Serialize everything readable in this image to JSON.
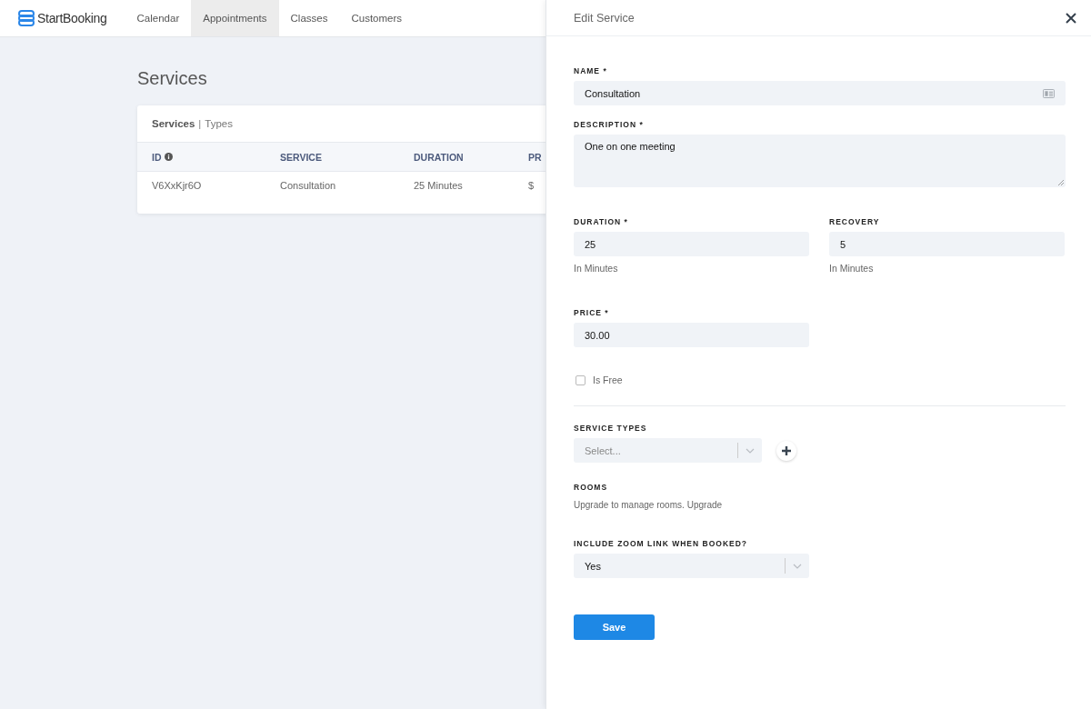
{
  "nav": {
    "brand": "StartBooking",
    "tabs": [
      {
        "label": "Calendar",
        "selected": false
      },
      {
        "label": "Appointments",
        "selected": true
      },
      {
        "label": "Classes",
        "selected": false
      },
      {
        "label": "Customers",
        "selected": false
      }
    ]
  },
  "page": {
    "title": "Services",
    "card": {
      "tabs": [
        {
          "label": "Services",
          "selected": true
        },
        {
          "label": "Types",
          "selected": false
        }
      ],
      "separator": "|",
      "columns": [
        {
          "label": "ID",
          "info": true
        },
        {
          "label": "SERVICE",
          "info": false
        },
        {
          "label": "DURATION",
          "info": false
        },
        {
          "label": "PR",
          "info": false
        }
      ],
      "rows": [
        [
          "V6XxKjr6O",
          "Consultation",
          "25 Minutes",
          "$"
        ]
      ]
    }
  },
  "drawer": {
    "title": "Edit Service",
    "name": {
      "label": "NAME *",
      "value": "Consultation"
    },
    "description": {
      "label": "DESCRIPTION *",
      "value": "One on one meeting"
    },
    "duration": {
      "label": "DURATION *",
      "value": "25",
      "hint": "In Minutes"
    },
    "recovery": {
      "label": "RECOVERY",
      "value": "5",
      "hint": "In Minutes"
    },
    "price": {
      "label": "PRICE *",
      "value": "30.00"
    },
    "is_free": {
      "label": "Is Free",
      "checked": false
    },
    "service_types": {
      "label": "SERVICE TYPES",
      "placeholder": "Select..."
    },
    "rooms": {
      "label": "ROOMS",
      "note": "Upgrade to manage rooms.",
      "link": "Upgrade"
    },
    "zoom": {
      "label": "INCLUDE ZOOM LINK WHEN BOOKED?",
      "value": "Yes"
    },
    "save": "Save"
  }
}
